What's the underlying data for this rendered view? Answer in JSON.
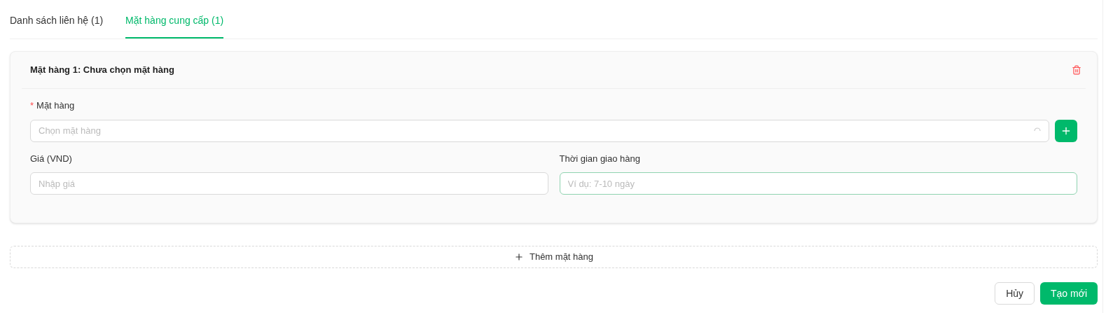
{
  "tabs": [
    {
      "label": "Danh sách liên hệ (1)",
      "selected": false
    },
    {
      "label": "Mặt hàng cung cấp (1)",
      "selected": true
    }
  ],
  "items": [
    {
      "title": "Mặt hàng 1: Chưa chọn mặt hàng",
      "product": {
        "label": "Mặt hàng",
        "required_mark": "*",
        "placeholder": "Chọn mặt hàng",
        "loading": true
      },
      "price": {
        "label": "Giá (VND)",
        "placeholder": "Nhập giá",
        "focused": false
      },
      "delivery": {
        "label": "Thời gian giao hàng",
        "placeholder": "Ví dụ: 7-10 ngày",
        "focused": true
      }
    }
  ],
  "add_item": {
    "label": "Thêm mặt hàng"
  },
  "buttons": [
    {
      "label": "Hủy",
      "kind": "secondary"
    },
    {
      "label": "Tạo mới",
      "kind": "primary"
    }
  ]
}
